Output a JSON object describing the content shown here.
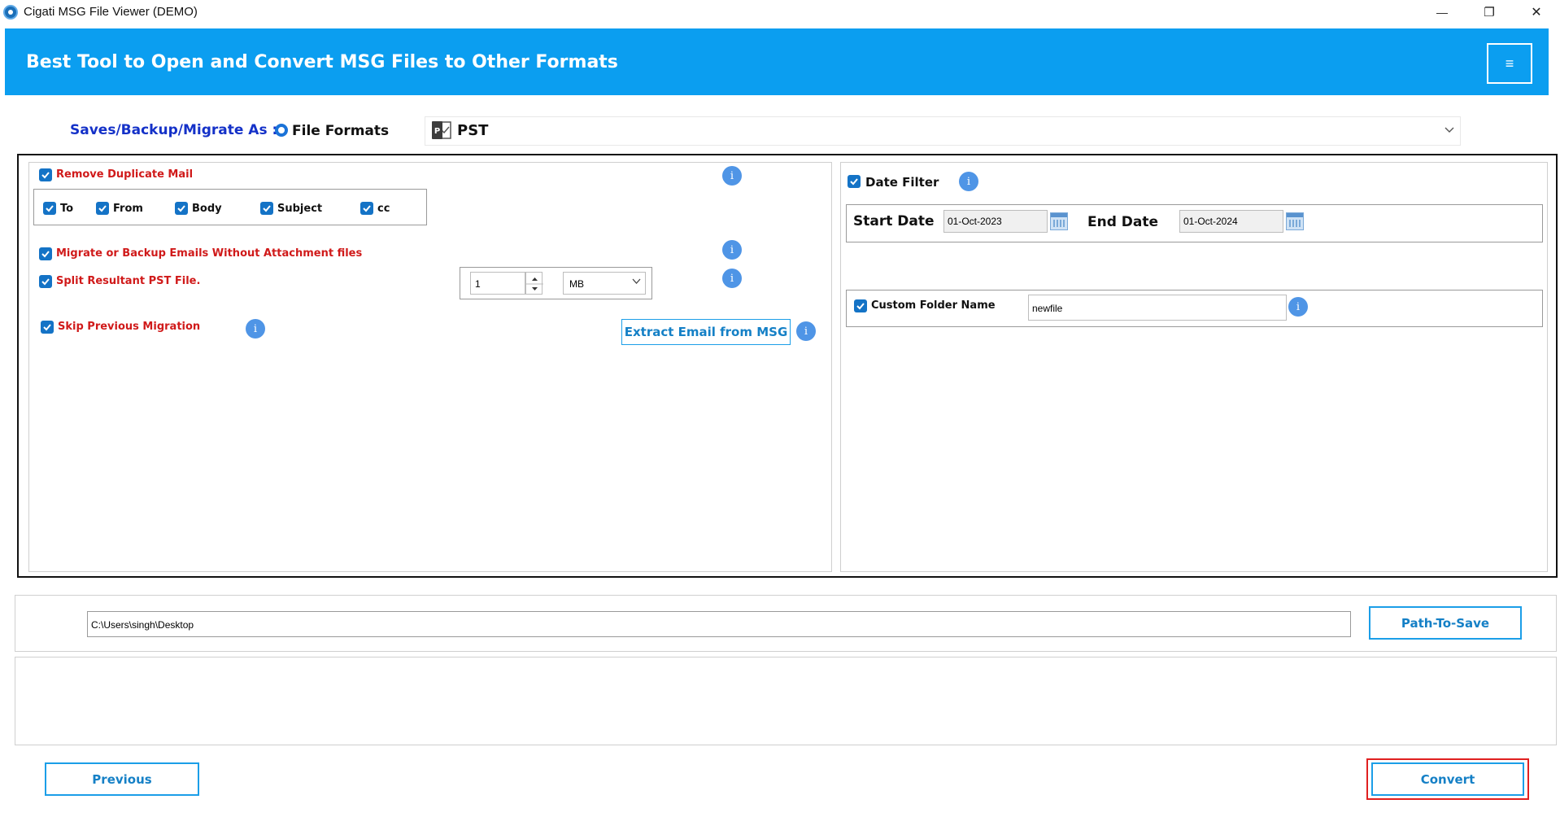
{
  "window": {
    "title": "Cigati MSG File Viewer (DEMO)",
    "minimize_glyph": "—",
    "restore_glyph": "❐",
    "close_glyph": "✕"
  },
  "header": {
    "title": "Best Tool to Open and Convert MSG Files to Other Formats",
    "menu_icon": "hamburger-icon",
    "menu_glyph": "≡"
  },
  "saves": {
    "label": "Saves/Backup/Migrate As :",
    "radio_label": "File Formats",
    "radio_selected": true,
    "format_value": "PST",
    "format_icon": "pst-file-icon"
  },
  "options": {
    "remove_duplicate": {
      "label": "Remove Duplicate Mail",
      "checked": true
    },
    "duplicate_fields": [
      {
        "label": "To",
        "checked": true
      },
      {
        "label": "From",
        "checked": true
      },
      {
        "label": "Body",
        "checked": true
      },
      {
        "label": "Subject",
        "checked": true
      },
      {
        "label": "cc",
        "checked": true
      }
    ],
    "without_attachment": {
      "label": "Migrate or Backup Emails Without Attachment files",
      "checked": true
    },
    "split_pst": {
      "label": "Split Resultant PST File.",
      "checked": true,
      "size_value": "1",
      "unit_value": "MB"
    },
    "skip_previous": {
      "label": "Skip Previous Migration",
      "checked": true
    },
    "extract_button_label": "Extract Email from MSG"
  },
  "right": {
    "date_filter": {
      "label": "Date Filter",
      "checked": true
    },
    "start_date_label": "Start Date",
    "start_date_value": "01-Oct-2023",
    "end_date_label": "End Date",
    "end_date_value": "01-Oct-2024",
    "custom_folder": {
      "label": "Custom Folder Name",
      "checked": true,
      "value": "newfile"
    }
  },
  "path": {
    "value": "C:\\Users\\singh\\Desktop",
    "button_label": "Path-To-Save"
  },
  "footer": {
    "previous_label": "Previous",
    "convert_label": "Convert"
  },
  "info_glyph": "i",
  "colors": {
    "header_bg": "#0b9ef0",
    "accent_blue": "#1b9ee8",
    "label_red": "#d01a1a",
    "saves_label_blue": "#1431c8",
    "highlight_red": "#e02020"
  }
}
